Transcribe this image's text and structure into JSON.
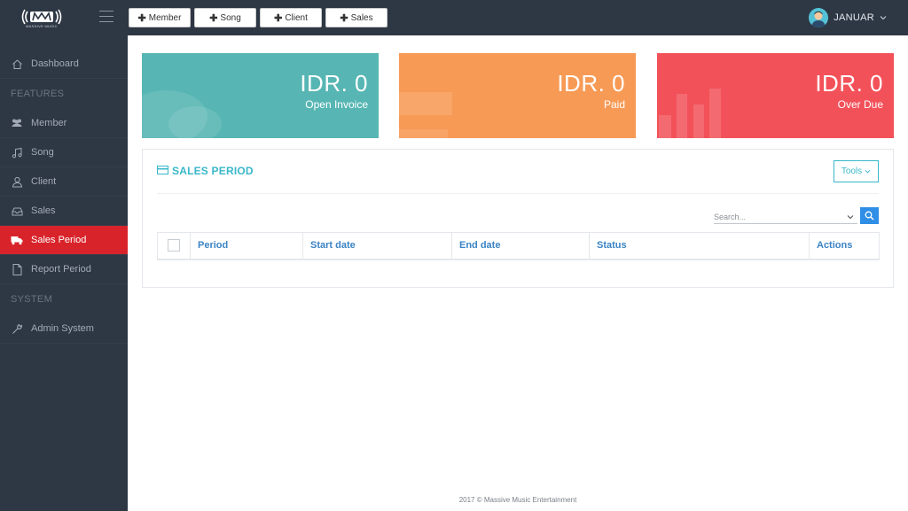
{
  "topbar": {
    "brand_text": "MASSIVE MUSIC",
    "quick_buttons": [
      {
        "label": "Member"
      },
      {
        "label": "Song"
      },
      {
        "label": "Client"
      },
      {
        "label": "Sales"
      }
    ],
    "user_name": "JANUAR"
  },
  "sidebar": {
    "dashboard": "Dashboard",
    "section_features": "FEATURES",
    "member": "Member",
    "song": "Song",
    "client": "Client",
    "sales": "Sales",
    "sales_period": "Sales Period",
    "report_period": "Report Period",
    "section_system": "SYSTEM",
    "admin_system": "Admin System"
  },
  "stats": [
    {
      "amount": "IDR. 0",
      "label": "Open Invoice",
      "color": "#57b6b3"
    },
    {
      "amount": "IDR. 0",
      "label": "Paid",
      "color": "#f79a55"
    },
    {
      "amount": "IDR. 0",
      "label": "Over Due",
      "color": "#f35159"
    }
  ],
  "panel": {
    "title": "SALES PERIOD",
    "tools_label": "Tools",
    "search_placeholder": "Search...",
    "columns": [
      "Period",
      "Start date",
      "End date",
      "Status",
      "Actions"
    ]
  },
  "footer": "2017 © Massive Music Entertainment",
  "colors": {
    "sidebar_bg": "#2e3744",
    "active_item": "#d8232a",
    "accent": "#39b7c9",
    "table_header": "#3a83c4",
    "search_button": "#2f8ee6"
  },
  "icons": {
    "logo": "massive-music-logo",
    "dashboard": "home-icon",
    "member": "users-icon",
    "song": "music-note-icon",
    "client": "user-icon",
    "sales": "inbox-icon",
    "sales_period": "truck-icon",
    "report_period": "document-icon",
    "admin_system": "wrench-icon",
    "panel_title": "credit-card-icon",
    "search": "search-icon"
  }
}
